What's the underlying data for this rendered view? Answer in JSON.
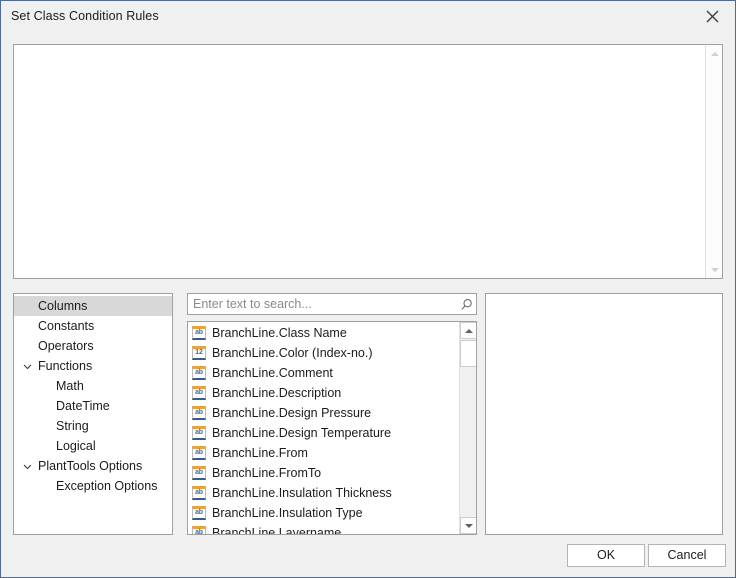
{
  "window": {
    "title": "Set Class Condition Rules",
    "close_icon": "close-icon",
    "border_color": "#4f6a96",
    "background": "#f0f0f0"
  },
  "editor": {
    "value": "",
    "scroll": {
      "up_icon": "scroll-up-arrow-icon",
      "down_icon": "scroll-down-arrow-icon"
    }
  },
  "tree": {
    "items": [
      {
        "label": "Columns",
        "level": 0,
        "selected": true,
        "chevron": ""
      },
      {
        "label": "Constants",
        "level": 0,
        "selected": false,
        "chevron": ""
      },
      {
        "label": "Operators",
        "level": 0,
        "selected": false,
        "chevron": ""
      },
      {
        "label": "Functions",
        "level": 0,
        "selected": false,
        "chevron": "chevron-down-icon"
      },
      {
        "label": "Math",
        "level": 1,
        "selected": false,
        "chevron": ""
      },
      {
        "label": "DateTime",
        "level": 1,
        "selected": false,
        "chevron": ""
      },
      {
        "label": "String",
        "level": 1,
        "selected": false,
        "chevron": ""
      },
      {
        "label": "Logical",
        "level": 1,
        "selected": false,
        "chevron": ""
      },
      {
        "label": "PlantTools Options",
        "level": 0,
        "selected": false,
        "chevron": "chevron-down-icon"
      },
      {
        "label": "Exception Options",
        "level": 1,
        "selected": false,
        "chevron": ""
      }
    ]
  },
  "search": {
    "value": "",
    "placeholder": "Enter text to search...",
    "icon": "search-icon"
  },
  "list": {
    "items": [
      {
        "label": "BranchLine.Class Name",
        "icon": "ab"
      },
      {
        "label": "BranchLine.Color (Index-no.)",
        "icon": "12"
      },
      {
        "label": "BranchLine.Comment",
        "icon": "ab"
      },
      {
        "label": "BranchLine.Description",
        "icon": "ab"
      },
      {
        "label": "BranchLine.Design Pressure",
        "icon": "ab"
      },
      {
        "label": "BranchLine.Design Temperature",
        "icon": "ab"
      },
      {
        "label": "BranchLine.From",
        "icon": "ab"
      },
      {
        "label": "BranchLine.FromTo",
        "icon": "ab"
      },
      {
        "label": "BranchLine.Insulation Thickness",
        "icon": "ab"
      },
      {
        "label": "BranchLine.Insulation Type",
        "icon": "ab"
      },
      {
        "label": "BranchLine.Layername",
        "icon": "ab"
      }
    ],
    "scroll": {
      "up_icon": "scroll-up-arrow-icon",
      "down_icon": "scroll-down-arrow-icon"
    }
  },
  "preview": {
    "value": ""
  },
  "footer": {
    "ok_label": "OK",
    "cancel_label": "Cancel"
  },
  "colors": {
    "icon_orange": "#e8a33d",
    "icon_blue": "#3b6ea5",
    "selection_gray": "#d8d8d8",
    "window_border": "#4f6a96"
  }
}
